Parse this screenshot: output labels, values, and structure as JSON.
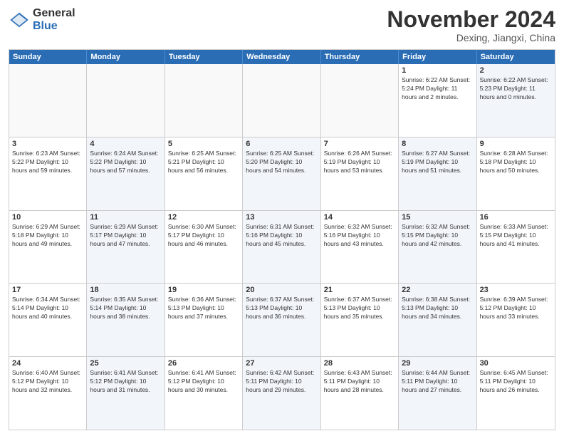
{
  "header": {
    "logo_general": "General",
    "logo_blue": "Blue",
    "month_title": "November 2024",
    "location": "Dexing, Jiangxi, China"
  },
  "weekdays": [
    "Sunday",
    "Monday",
    "Tuesday",
    "Wednesday",
    "Thursday",
    "Friday",
    "Saturday"
  ],
  "rows": [
    {
      "cells": [
        {
          "day": "",
          "text": "",
          "empty": true
        },
        {
          "day": "",
          "text": "",
          "empty": true
        },
        {
          "day": "",
          "text": "",
          "empty": true
        },
        {
          "day": "",
          "text": "",
          "empty": true
        },
        {
          "day": "",
          "text": "",
          "empty": true
        },
        {
          "day": "1",
          "text": "Sunrise: 6:22 AM\nSunset: 5:24 PM\nDaylight: 11 hours and 2 minutes.",
          "empty": false,
          "alt": false
        },
        {
          "day": "2",
          "text": "Sunrise: 6:22 AM\nSunset: 5:23 PM\nDaylight: 11 hours and 0 minutes.",
          "empty": false,
          "alt": true
        }
      ]
    },
    {
      "cells": [
        {
          "day": "3",
          "text": "Sunrise: 6:23 AM\nSunset: 5:22 PM\nDaylight: 10 hours and 59 minutes.",
          "empty": false,
          "alt": false
        },
        {
          "day": "4",
          "text": "Sunrise: 6:24 AM\nSunset: 5:22 PM\nDaylight: 10 hours and 57 minutes.",
          "empty": false,
          "alt": true
        },
        {
          "day": "5",
          "text": "Sunrise: 6:25 AM\nSunset: 5:21 PM\nDaylight: 10 hours and 56 minutes.",
          "empty": false,
          "alt": false
        },
        {
          "day": "6",
          "text": "Sunrise: 6:25 AM\nSunset: 5:20 PM\nDaylight: 10 hours and 54 minutes.",
          "empty": false,
          "alt": true
        },
        {
          "day": "7",
          "text": "Sunrise: 6:26 AM\nSunset: 5:19 PM\nDaylight: 10 hours and 53 minutes.",
          "empty": false,
          "alt": false
        },
        {
          "day": "8",
          "text": "Sunrise: 6:27 AM\nSunset: 5:19 PM\nDaylight: 10 hours and 51 minutes.",
          "empty": false,
          "alt": true
        },
        {
          "day": "9",
          "text": "Sunrise: 6:28 AM\nSunset: 5:18 PM\nDaylight: 10 hours and 50 minutes.",
          "empty": false,
          "alt": false
        }
      ]
    },
    {
      "cells": [
        {
          "day": "10",
          "text": "Sunrise: 6:29 AM\nSunset: 5:18 PM\nDaylight: 10 hours and 49 minutes.",
          "empty": false,
          "alt": false
        },
        {
          "day": "11",
          "text": "Sunrise: 6:29 AM\nSunset: 5:17 PM\nDaylight: 10 hours and 47 minutes.",
          "empty": false,
          "alt": true
        },
        {
          "day": "12",
          "text": "Sunrise: 6:30 AM\nSunset: 5:17 PM\nDaylight: 10 hours and 46 minutes.",
          "empty": false,
          "alt": false
        },
        {
          "day": "13",
          "text": "Sunrise: 6:31 AM\nSunset: 5:16 PM\nDaylight: 10 hours and 45 minutes.",
          "empty": false,
          "alt": true
        },
        {
          "day": "14",
          "text": "Sunrise: 6:32 AM\nSunset: 5:16 PM\nDaylight: 10 hours and 43 minutes.",
          "empty": false,
          "alt": false
        },
        {
          "day": "15",
          "text": "Sunrise: 6:32 AM\nSunset: 5:15 PM\nDaylight: 10 hours and 42 minutes.",
          "empty": false,
          "alt": true
        },
        {
          "day": "16",
          "text": "Sunrise: 6:33 AM\nSunset: 5:15 PM\nDaylight: 10 hours and 41 minutes.",
          "empty": false,
          "alt": false
        }
      ]
    },
    {
      "cells": [
        {
          "day": "17",
          "text": "Sunrise: 6:34 AM\nSunset: 5:14 PM\nDaylight: 10 hours and 40 minutes.",
          "empty": false,
          "alt": false
        },
        {
          "day": "18",
          "text": "Sunrise: 6:35 AM\nSunset: 5:14 PM\nDaylight: 10 hours and 38 minutes.",
          "empty": false,
          "alt": true
        },
        {
          "day": "19",
          "text": "Sunrise: 6:36 AM\nSunset: 5:13 PM\nDaylight: 10 hours and 37 minutes.",
          "empty": false,
          "alt": false
        },
        {
          "day": "20",
          "text": "Sunrise: 6:37 AM\nSunset: 5:13 PM\nDaylight: 10 hours and 36 minutes.",
          "empty": false,
          "alt": true
        },
        {
          "day": "21",
          "text": "Sunrise: 6:37 AM\nSunset: 5:13 PM\nDaylight: 10 hours and 35 minutes.",
          "empty": false,
          "alt": false
        },
        {
          "day": "22",
          "text": "Sunrise: 6:38 AM\nSunset: 5:13 PM\nDaylight: 10 hours and 34 minutes.",
          "empty": false,
          "alt": true
        },
        {
          "day": "23",
          "text": "Sunrise: 6:39 AM\nSunset: 5:12 PM\nDaylight: 10 hours and 33 minutes.",
          "empty": false,
          "alt": false
        }
      ]
    },
    {
      "cells": [
        {
          "day": "24",
          "text": "Sunrise: 6:40 AM\nSunset: 5:12 PM\nDaylight: 10 hours and 32 minutes.",
          "empty": false,
          "alt": false
        },
        {
          "day": "25",
          "text": "Sunrise: 6:41 AM\nSunset: 5:12 PM\nDaylight: 10 hours and 31 minutes.",
          "empty": false,
          "alt": true
        },
        {
          "day": "26",
          "text": "Sunrise: 6:41 AM\nSunset: 5:12 PM\nDaylight: 10 hours and 30 minutes.",
          "empty": false,
          "alt": false
        },
        {
          "day": "27",
          "text": "Sunrise: 6:42 AM\nSunset: 5:11 PM\nDaylight: 10 hours and 29 minutes.",
          "empty": false,
          "alt": true
        },
        {
          "day": "28",
          "text": "Sunrise: 6:43 AM\nSunset: 5:11 PM\nDaylight: 10 hours and 28 minutes.",
          "empty": false,
          "alt": false
        },
        {
          "day": "29",
          "text": "Sunrise: 6:44 AM\nSunset: 5:11 PM\nDaylight: 10 hours and 27 minutes.",
          "empty": false,
          "alt": true
        },
        {
          "day": "30",
          "text": "Sunrise: 6:45 AM\nSunset: 5:11 PM\nDaylight: 10 hours and 26 minutes.",
          "empty": false,
          "alt": false
        }
      ]
    }
  ]
}
